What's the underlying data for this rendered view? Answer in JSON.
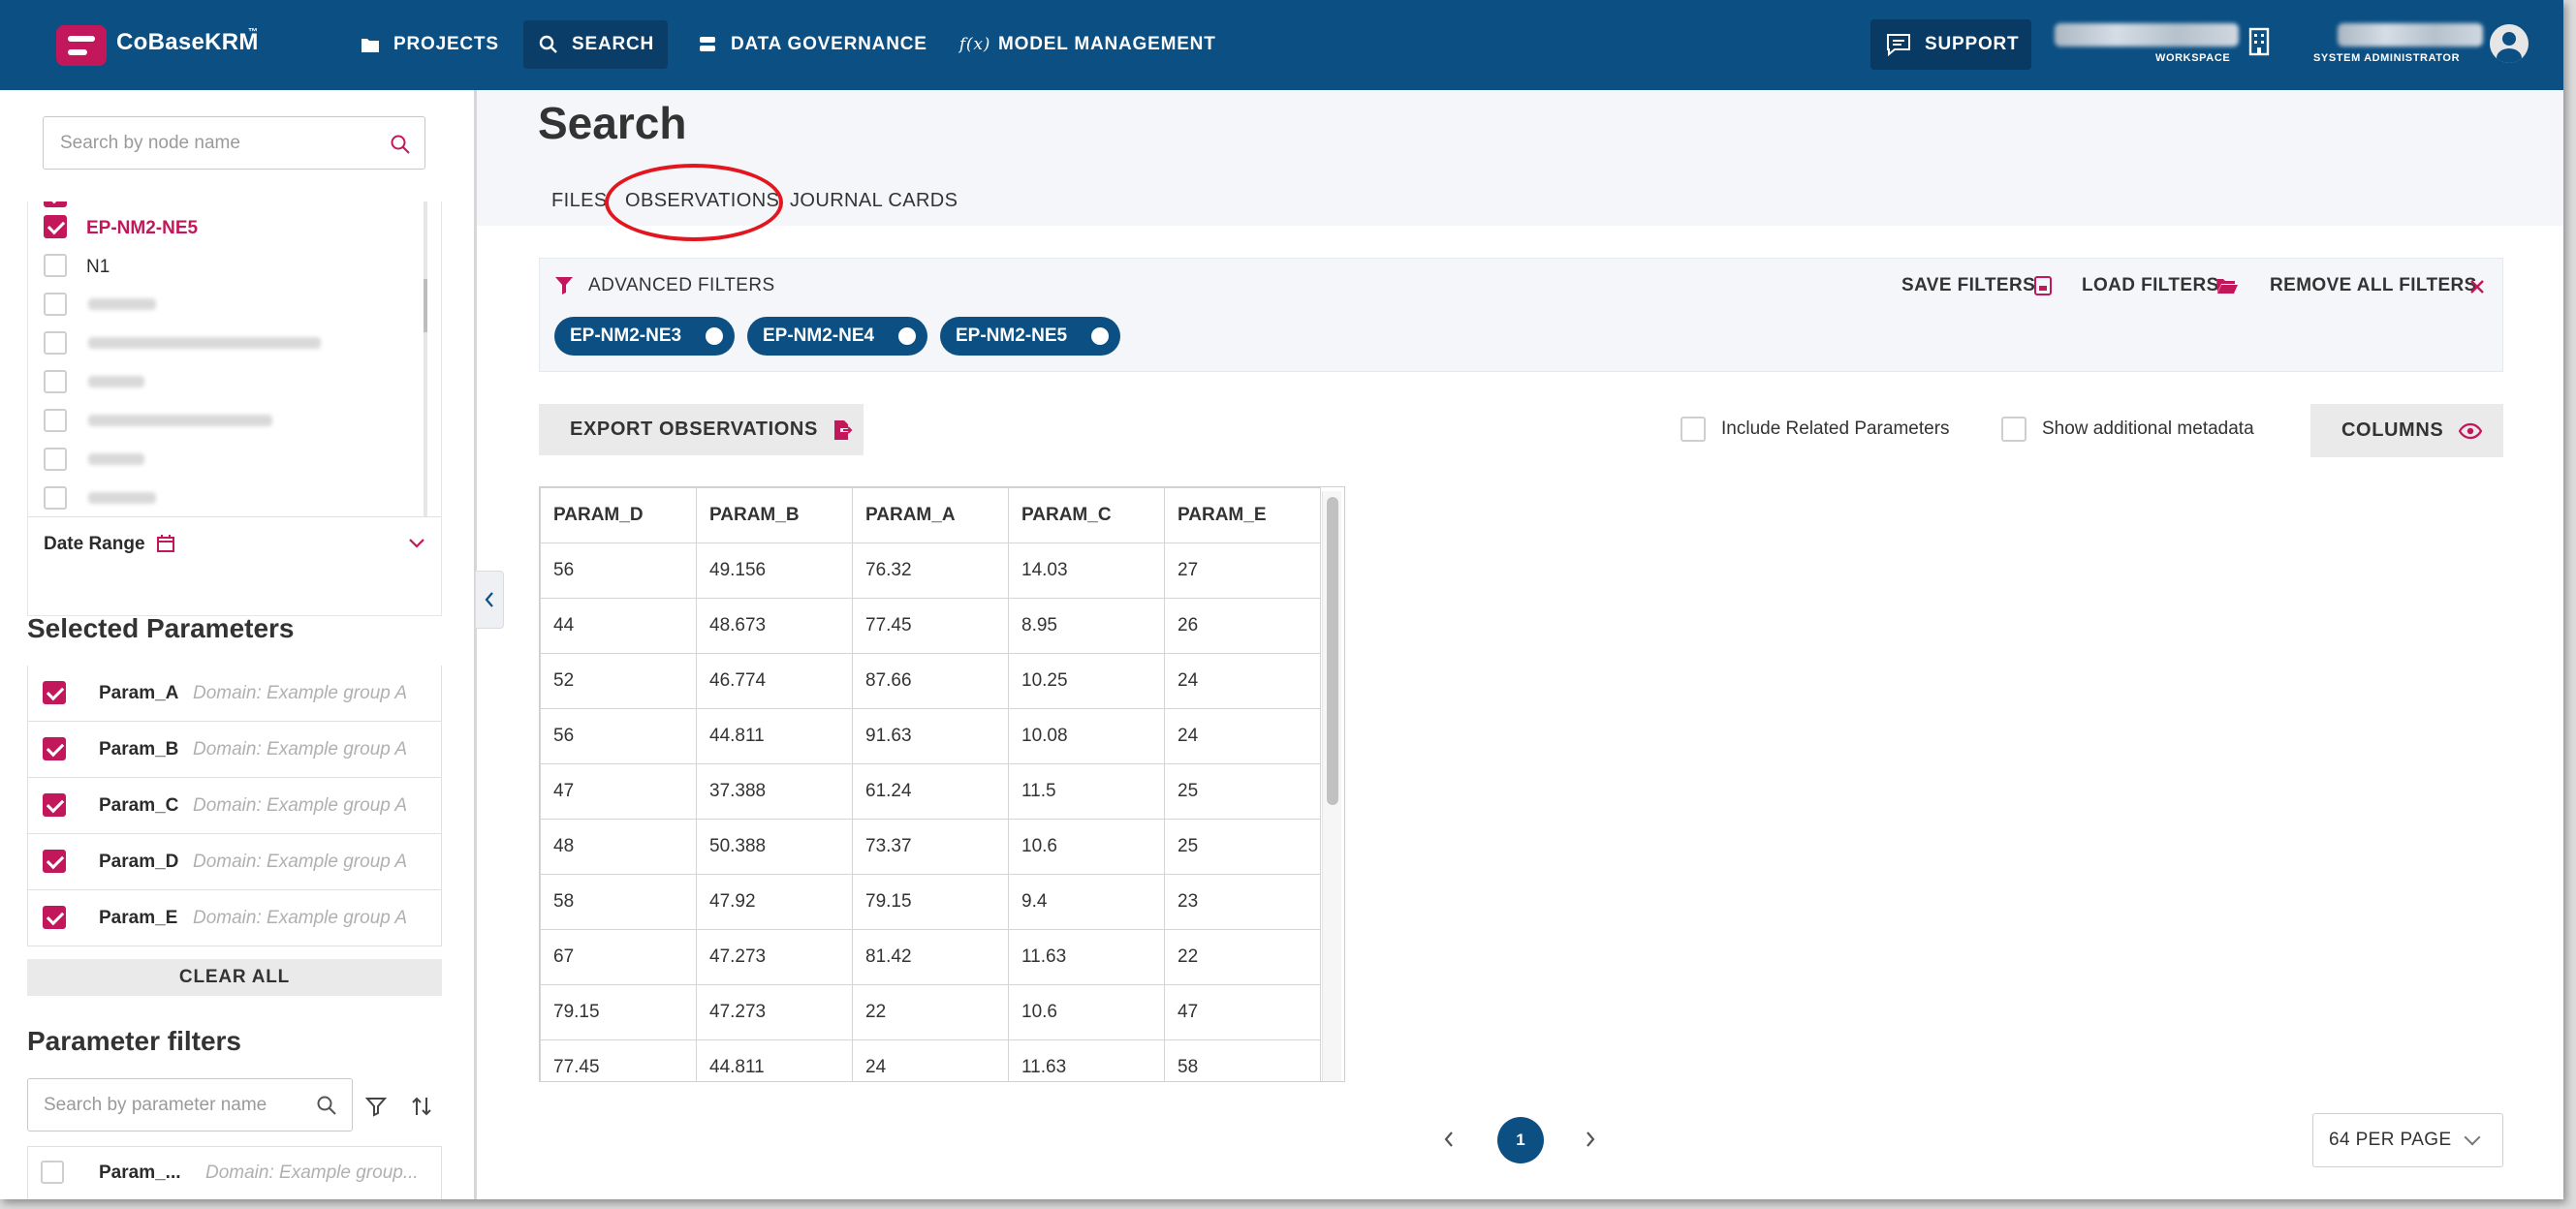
{
  "header": {
    "logo": "CoBaseKRM",
    "logo_tm": "™",
    "nav": [
      {
        "label": "PROJECTS",
        "icon": "folder-icon"
      },
      {
        "label": "SEARCH",
        "icon": "search-icon"
      },
      {
        "label": "DATA GOVERNANCE",
        "icon": "database-icon"
      },
      {
        "label": "MODEL MANAGEMENT",
        "icon": "function-icon",
        "glyph": "f(x)"
      }
    ],
    "support": "SUPPORT",
    "workspace_label": "WORKSPACE",
    "role_label": "SYSTEM ADMINISTRATOR"
  },
  "sidebar": {
    "node_search_placeholder": "Search by node name",
    "nodes": [
      {
        "label": "EP-NM2-NE5",
        "checked": true
      },
      {
        "label": "N1",
        "checked": false
      }
    ],
    "date_range_label": "Date Range",
    "selected_parameters_title": "Selected Parameters",
    "selected_parameters": [
      {
        "name": "Param_A",
        "domain": "Domain: Example group A"
      },
      {
        "name": "Param_B",
        "domain": "Domain: Example group A"
      },
      {
        "name": "Param_C",
        "domain": "Domain: Example group A"
      },
      {
        "name": "Param_D",
        "domain": "Domain: Example group A"
      },
      {
        "name": "Param_E",
        "domain": "Domain: Example group A"
      }
    ],
    "clear_all": "CLEAR ALL",
    "parameter_filters_title": "Parameter filters",
    "param_search_placeholder": "Search by parameter name",
    "filter_list_item": {
      "name": "Param_...",
      "domain": "Domain: Example group..."
    }
  },
  "main": {
    "title": "Search",
    "tabs": [
      "FILES",
      "OBSERVATIONS",
      "JOURNAL CARDS"
    ],
    "advanced_filters": "ADVANCED FILTERS",
    "save_filters": "SAVE FILTERS",
    "load_filters": "LOAD FILTERS",
    "remove_all_filters": "REMOVE ALL FILTERS",
    "chips": [
      "EP-NM2-NE3",
      "EP-NM2-NE4",
      "EP-NM2-NE5"
    ],
    "export_observations": "EXPORT OBSERVATIONS",
    "include_related": "Include Related Parameters",
    "show_metadata": "Show additional metadata",
    "columns": "COLUMNS",
    "table": {
      "headers": [
        "PARAM_D",
        "PARAM_B",
        "PARAM_A",
        "PARAM_C",
        "PARAM_E"
      ],
      "rows": [
        [
          "56",
          "49.156",
          "76.32",
          "14.03",
          "27"
        ],
        [
          "44",
          "48.673",
          "77.45",
          "8.95",
          "26"
        ],
        [
          "52",
          "46.774",
          "87.66",
          "10.25",
          "24"
        ],
        [
          "56",
          "44.811",
          "91.63",
          "10.08",
          "24"
        ],
        [
          "47",
          "37.388",
          "61.24",
          "11.5",
          "25"
        ],
        [
          "48",
          "50.388",
          "73.37",
          "10.6",
          "25"
        ],
        [
          "58",
          "47.92",
          "79.15",
          "9.4",
          "23"
        ],
        [
          "67",
          "47.273",
          "81.42",
          "11.63",
          "22"
        ],
        [
          "79.15",
          "47.273",
          "22",
          "10.6",
          "47"
        ],
        [
          "77.45",
          "44.811",
          "24",
          "11.63",
          "58"
        ]
      ]
    },
    "pagination": {
      "current_page": "1",
      "per_page": "64 PER PAGE"
    }
  },
  "colors": {
    "brand_blue": "#0b4f83",
    "accent_magenta": "#c2185b",
    "annotation_red": "#e3161f"
  }
}
